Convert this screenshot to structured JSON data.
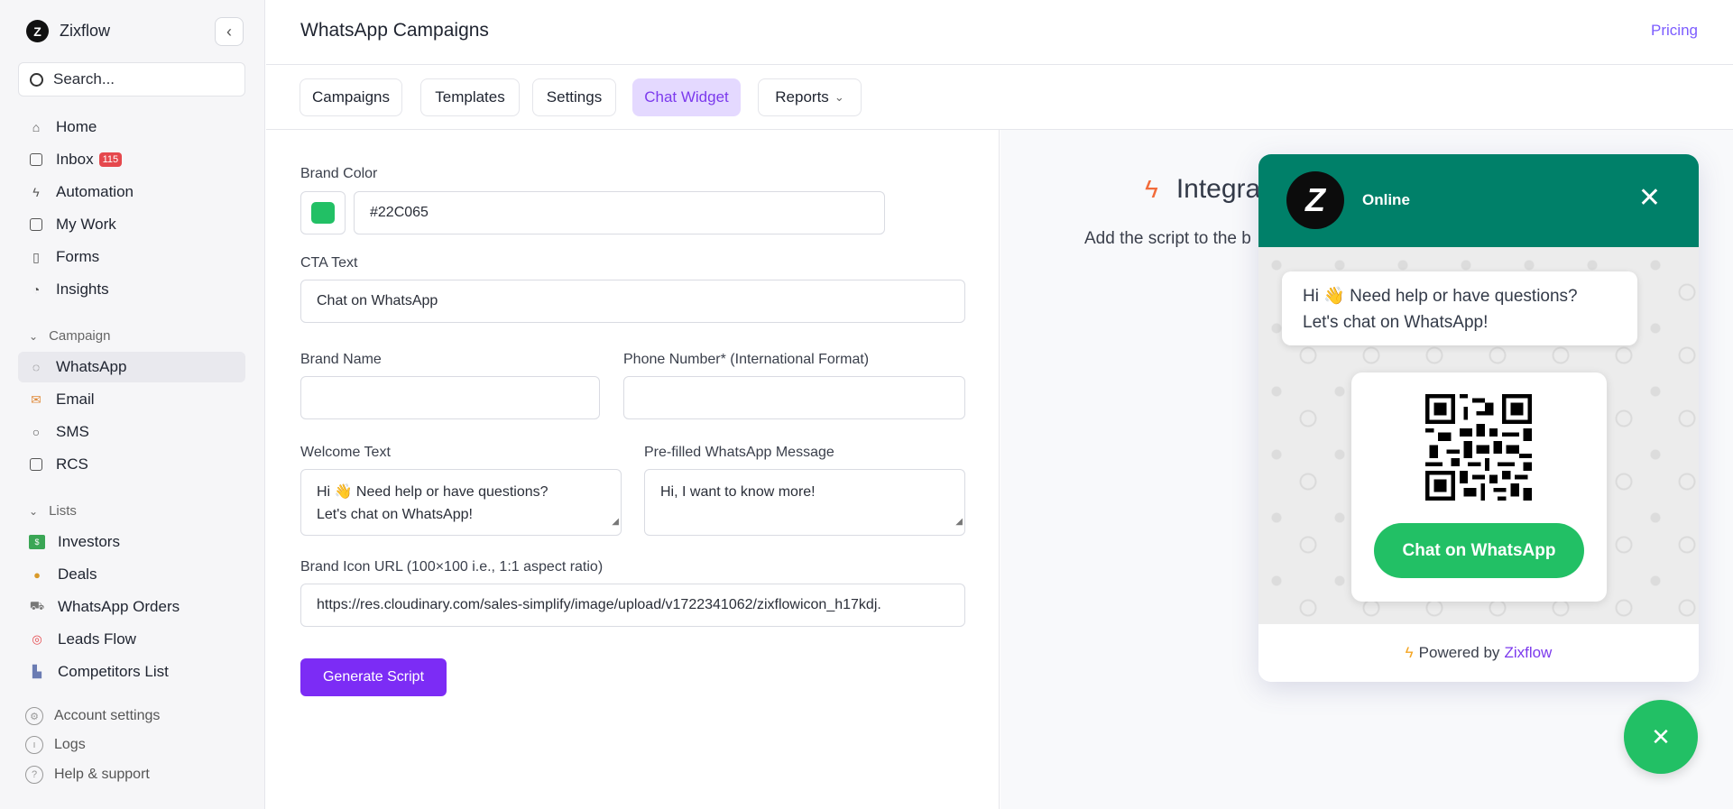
{
  "app": {
    "name": "Zixflow"
  },
  "search": {
    "placeholder": "Search..."
  },
  "nav": {
    "main": [
      {
        "label": "Home",
        "icon": "home-icon"
      },
      {
        "label": "Inbox",
        "icon": "inbox-icon",
        "badge": "115"
      },
      {
        "label": "Automation",
        "icon": "automation-icon"
      },
      {
        "label": "My Work",
        "icon": "my-work-icon"
      },
      {
        "label": "Forms",
        "icon": "forms-icon"
      },
      {
        "label": "Insights",
        "icon": "insights-icon"
      }
    ],
    "campaign_section": "Campaign",
    "campaign": [
      {
        "label": "WhatsApp",
        "icon": "whatsapp-icon",
        "active": true
      },
      {
        "label": "Email",
        "icon": "email-icon"
      },
      {
        "label": "SMS",
        "icon": "sms-icon"
      },
      {
        "label": "RCS",
        "icon": "rcs-icon"
      }
    ],
    "lists_section": "Lists",
    "lists": [
      {
        "label": "Investors",
        "icon": "money-icon"
      },
      {
        "label": "Deals",
        "icon": "money-bag-icon"
      },
      {
        "label": "WhatsApp Orders",
        "icon": "cart-icon"
      },
      {
        "label": "Leads Flow",
        "icon": "target-icon"
      },
      {
        "label": "Competitors List",
        "icon": "factory-icon"
      }
    ],
    "footer": [
      {
        "label": "Account settings",
        "icon": "gear-icon"
      },
      {
        "label": "Logs",
        "icon": "clock-icon"
      },
      {
        "label": "Help & support",
        "icon": "help-icon"
      }
    ]
  },
  "header": {
    "title": "WhatsApp Campaigns",
    "pricing": "Pricing"
  },
  "tabs": [
    {
      "label": "Campaigns"
    },
    {
      "label": "Templates"
    },
    {
      "label": "Settings"
    },
    {
      "label": "Chat Widget",
      "active": true
    },
    {
      "label": "Reports"
    }
  ],
  "form": {
    "brand_color_label": "Brand Color",
    "brand_color_value": "#22C065",
    "cta_label": "CTA Text",
    "cta_value": "Chat on WhatsApp",
    "brand_name_label": "Brand Name",
    "brand_name_value": "",
    "phone_label": "Phone Number* (International Format)",
    "phone_value": "",
    "welcome_label": "Welcome Text",
    "welcome_line1": "Hi 👋 Need help or have questions?",
    "welcome_line2": "Let's chat on WhatsApp!",
    "prefill_label": "Pre-filled WhatsApp Message",
    "prefill_value": "Hi, I want to know more!",
    "icon_url_label": "Brand Icon URL (100×100 i.e., 1:1 aspect ratio)",
    "icon_url_value": "https://res.cloudinary.com/sales-simplify/image/upload/v1722341062/zixflowicon_h17kdj.",
    "generate_button": "Generate Script"
  },
  "integration": {
    "title": "Integra",
    "subtitle": "Add the script to the b"
  },
  "widget": {
    "status": "Online",
    "bubble_line1": "Hi 👋 Need help or have questions?",
    "bubble_line2": "Let's chat on WhatsApp!",
    "cta": "Chat on WhatsApp",
    "powered_by": "Powered by",
    "powered_link": "Zixflow",
    "header_color": "#008069",
    "cta_color": "#22C065"
  }
}
